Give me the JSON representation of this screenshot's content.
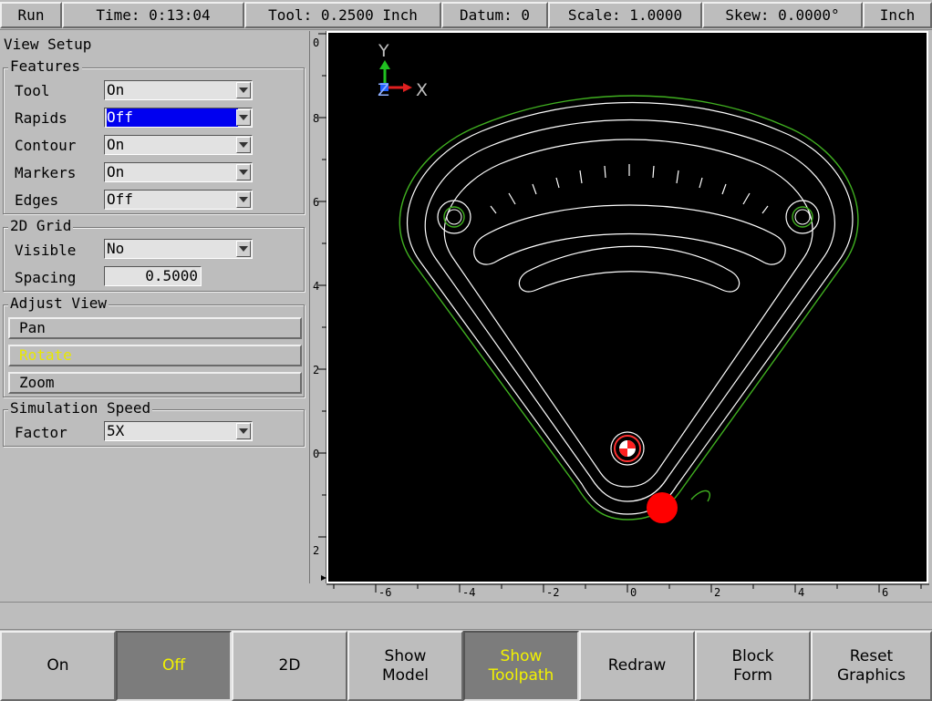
{
  "statusbar": {
    "run": "Run",
    "time": "Time: 0:13:04",
    "tool": "Tool: 0.2500 Inch",
    "datum": "Datum: 0",
    "scale": "Scale: 1.0000",
    "skew": "Skew: 0.0000°",
    "units": "Inch"
  },
  "panel": {
    "title": "View Setup",
    "features": {
      "title": "Features",
      "items": [
        {
          "label": "Tool",
          "value": "On"
        },
        {
          "label": "Rapids",
          "value": "Off"
        },
        {
          "label": "Contour",
          "value": "On"
        },
        {
          "label": "Markers",
          "value": "On"
        },
        {
          "label": "Edges",
          "value": "Off"
        }
      ]
    },
    "grid": {
      "title": "2D Grid",
      "visible_label": "Visible",
      "visible_value": "No",
      "spacing_label": "Spacing",
      "spacing_value": "0.5000"
    },
    "adjust": {
      "title": "Adjust View",
      "pan": "Pan",
      "rotate": "Rotate",
      "zoom": "Zoom"
    },
    "speed": {
      "title": "Simulation Speed",
      "factor_label": "Factor",
      "factor_value": "5X"
    }
  },
  "view": {
    "axis_y": "Y",
    "axis_z": "Z",
    "axis_x": "X",
    "ruler_left": [
      "0",
      "8",
      "6",
      "4",
      "2",
      "0",
      "2"
    ],
    "ruler_bottom": [
      "-6",
      "-4",
      "-2",
      "0",
      "2",
      "4",
      "6"
    ],
    "colors": {
      "toolpath": "#40b020",
      "contour": "#ffffff",
      "tool": "#ff0000",
      "x_axis": "#e02020",
      "y_axis": "#20c020",
      "z_axis": "#2060ff"
    }
  },
  "message": "",
  "softkeys": [
    {
      "label": "On",
      "active": false
    },
    {
      "label": "Off",
      "active": true
    },
    {
      "label": "2D",
      "active": false
    },
    {
      "label": "Show\nModel",
      "active": false
    },
    {
      "label": "Show\nToolpath",
      "active": true
    },
    {
      "label": "Redraw",
      "active": false
    },
    {
      "label": "Block\nForm",
      "active": false
    },
    {
      "label": "Reset\nGraphics",
      "active": false
    }
  ]
}
